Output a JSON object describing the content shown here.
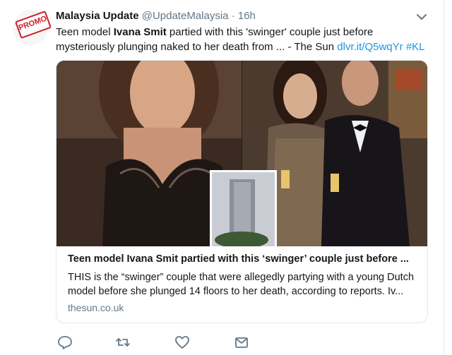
{
  "tweet": {
    "promo_label": "PROMO",
    "display_name": "Malaysia Update",
    "handle": "@UpdateMalaysia",
    "separator": "·",
    "time": "16h",
    "text": {
      "part1": "Teen model ",
      "bold": "Ivana Smit",
      "part2": " partied with this 'swinger' couple just before mysteriously plunging naked to her death from ... - The Sun ",
      "link": "dlvr.it/Q5wqYr",
      "space": " ",
      "hashtag": "#KL"
    }
  },
  "card": {
    "title": "Teen model Ivana Smit partied with this ‘swinger’ couple just before ...",
    "description": "THIS is the “swinger” couple that were allegedly partying with a young Dutch model before she plunged 14 floors to her death, according to reports. Iv...",
    "domain": "thesun.co.uk"
  },
  "icons": {
    "avatar": "promo-stamp-avatar",
    "caret": "chevron-down-icon",
    "reply": "reply-icon",
    "retweet": "retweet-icon",
    "like": "heart-icon",
    "dm": "envelope-icon"
  },
  "colors": {
    "link": "#1b95e0",
    "secondary_text": "#657786",
    "border": "#e1e8ed",
    "promo_red": "#cc2027"
  }
}
